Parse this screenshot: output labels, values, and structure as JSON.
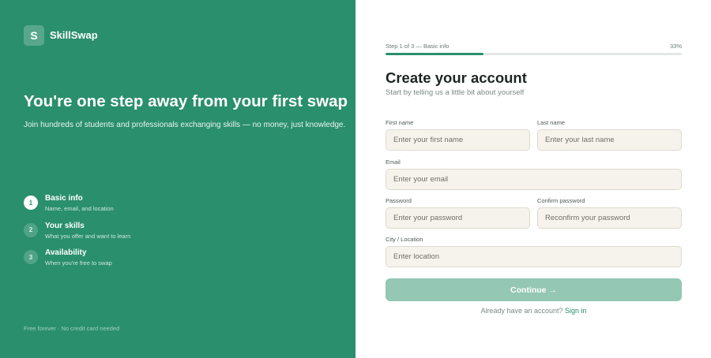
{
  "brand": {
    "logo_letter": "S",
    "name": "SkillSwap"
  },
  "hero": {
    "headline": "You're one step away from your first swap",
    "subline": "Join hundreds of students and professionals exchanging skills — no money, just knowledge."
  },
  "steps": [
    {
      "number": "1",
      "title": "Basic info",
      "subtitle": "Name, email, and location",
      "active": true
    },
    {
      "number": "2",
      "title": "Your skills",
      "subtitle": "What you offer and want to learn",
      "active": false
    },
    {
      "number": "3",
      "title": "Availability",
      "subtitle": "When you're free to swap",
      "active": false
    }
  ],
  "footer_note": "Free forever · No credit card needed",
  "progress": {
    "label": "Step 1 of 3 — Basic info",
    "percent_text": "33%",
    "fraction": 0.33
  },
  "form": {
    "title": "Create your account",
    "subtitle": "Start by telling us a little bit about yourself",
    "first_name": {
      "label": "First name",
      "placeholder": "Enter your first name",
      "value": ""
    },
    "last_name": {
      "label": "Last name",
      "placeholder": "Enter your last name",
      "value": ""
    },
    "email": {
      "label": "Email",
      "placeholder": "Enter your email",
      "value": ""
    },
    "password": {
      "label": "Password",
      "placeholder": "Enter your password",
      "value": ""
    },
    "confirm_password": {
      "label": "Confirm password",
      "placeholder": "Reconfirm your password",
      "value": ""
    },
    "city": {
      "label": "City / Location",
      "placeholder": "Enter location",
      "value": ""
    },
    "continue_label": "Continue →",
    "signin_prompt": "Already have an account?",
    "signin_link": "Sign in"
  },
  "colors": {
    "accent": "#2a8f6c",
    "button_disabled": "#94c7b4",
    "input_bg": "#f6f3ec"
  }
}
